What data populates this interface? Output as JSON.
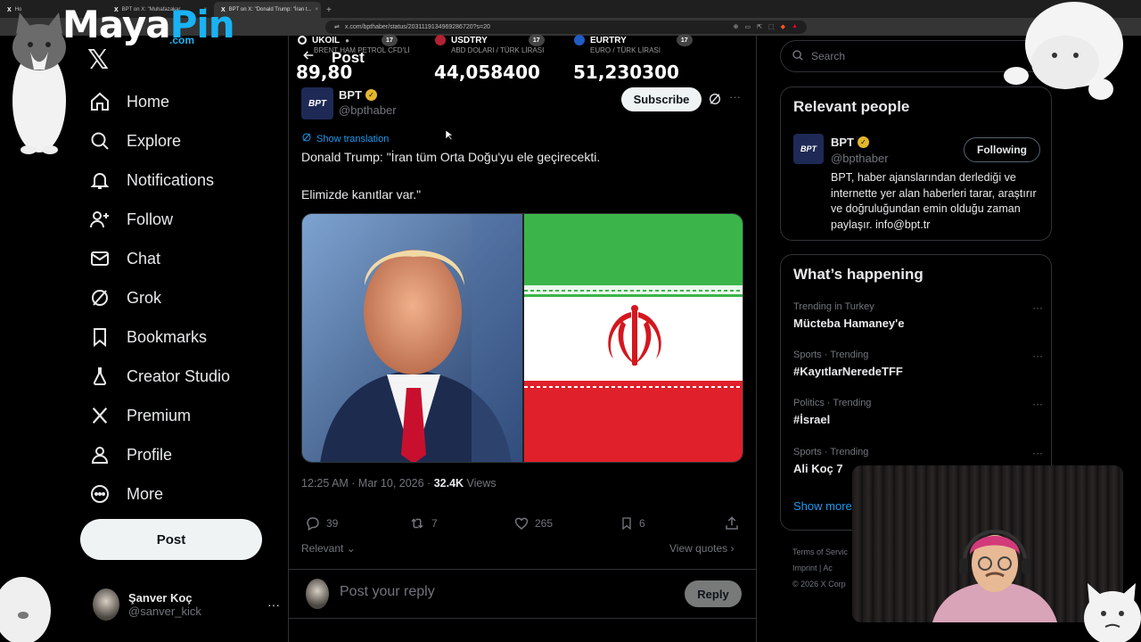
{
  "browser": {
    "tabs": [
      {
        "title": "Ho"
      },
      {
        "title": "BPT on X: \"Muhafazakar..."
      },
      {
        "title": "BPT on X: \"Donald Trump: \"İran t..."
      }
    ],
    "url": "x.com/bpthaber/status/2031119134969286720?s=20"
  },
  "overlay": {
    "logo_main": "Maya",
    "logo_accent": "Pin",
    "logo_suffix": ".com"
  },
  "nav": {
    "items": [
      {
        "label": "Home",
        "icon": "home-icon"
      },
      {
        "label": "Explore",
        "icon": "search-icon"
      },
      {
        "label": "Notifications",
        "icon": "bell-icon"
      },
      {
        "label": "Follow",
        "icon": "person-add-icon"
      },
      {
        "label": "Chat",
        "icon": "mail-icon"
      },
      {
        "label": "Grok",
        "icon": "grok-icon"
      },
      {
        "label": "Bookmarks",
        "icon": "bookmark-icon"
      },
      {
        "label": "Creator Studio",
        "icon": "flask-icon"
      },
      {
        "label": "Premium",
        "icon": "x-icon"
      },
      {
        "label": "Profile",
        "icon": "person-icon"
      },
      {
        "label": "More",
        "icon": "more-circle-icon"
      }
    ],
    "post_button": "Post",
    "account": {
      "name": "Şanver Koç",
      "handle": "@sanver_kick",
      "more": "···"
    }
  },
  "tickers": [
    {
      "symbol": "UKOIL",
      "sub": "BRENT HAM PETROL CFD'Lİ",
      "value": "89,80",
      "color": "#ffffff"
    },
    {
      "symbol": "USDTRY",
      "sub": "ABD DOLARI / TÜRK LİRASI",
      "value": "44,058400",
      "color": "#b22234"
    },
    {
      "symbol": "EURTRY",
      "sub": "EURO / TÜRK LİRASI",
      "value": "51,230300",
      "color": "#1f5cc4"
    }
  ],
  "post": {
    "header_title": "Post",
    "author_name": "BPT",
    "author_handle": "@bpthaber",
    "avatar_text": "BPT",
    "subscribe_label": "Subscribe",
    "more": "···",
    "show_translation": "Show translation",
    "text_line1": "Donald Trump: \"İran tüm Orta Doğu'yu ele geçirecekti.",
    "text_line2": "Elimizde kanıtlar var.\"",
    "time": "12:25 AM · Mar 10, 2026 · ",
    "views_count": "32.4K",
    "views_label": " Views",
    "replies": "39",
    "reposts": "7",
    "likes": "265",
    "bookmarks": "6",
    "relevant_label": "Relevant",
    "view_quotes": "View quotes",
    "reply_placeholder": "Post your reply",
    "reply_button": "Reply"
  },
  "sidebar": {
    "search_placeholder": "Search",
    "relevant_title": "Relevant people",
    "relevant_person": {
      "name": "BPT",
      "handle": "@bpthaber",
      "avatar_text": "BPT",
      "follow_label": "Following",
      "bio": "BPT, haber ajanslarından derlediği ve internette yer alan haberleri tarar, araştırır ve doğruluğundan emin olduğu zaman paylaşır. info@bpt.tr"
    },
    "happening_title": "What’s happening",
    "trends": [
      {
        "meta": "Trending in Turkey",
        "name": "Mücteba Hamaney'e"
      },
      {
        "meta": "Sports · Trending",
        "name": "#KayıtlarNeredeTFF"
      },
      {
        "meta": "Politics · Trending",
        "name": "#İsrael"
      },
      {
        "meta": "Sports · Trending",
        "name": "Ali Koç 7"
      }
    ],
    "show_more": "Show more",
    "footer_line1": "Terms of Servic",
    "footer_line2": "Imprint  |  Ac",
    "footer_line3": "© 2026 X Corp"
  }
}
